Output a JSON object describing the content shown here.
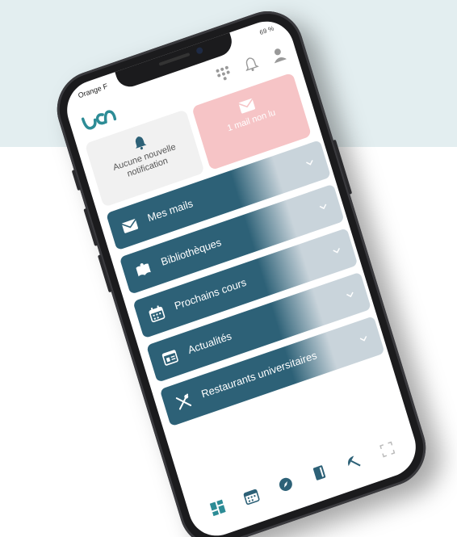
{
  "colors": {
    "background_top": "#e3eef0",
    "accent_teal": "#2d6177",
    "mail_tile": "#f6c4c6",
    "notif_tile": "#f1f1f1",
    "row_fade": "#c9d4db"
  },
  "status_bar": {
    "carrier": "Orange F",
    "battery": "69 %"
  },
  "top_icons": [
    "grid-icon",
    "bell-icon",
    "user-icon"
  ],
  "tiles": [
    {
      "id": "notifications",
      "icon": "bell-icon",
      "label": "Aucune nouvelle notification"
    },
    {
      "id": "mail",
      "icon": "envelope-icon",
      "label": "1 mail non lu"
    }
  ],
  "menu": [
    {
      "id": "mails",
      "icon": "envelope-icon",
      "label": "Mes mails"
    },
    {
      "id": "libraries",
      "icon": "book-icon",
      "label": "Bibliothèques"
    },
    {
      "id": "courses",
      "icon": "calendar-icon",
      "label": "Prochains cours"
    },
    {
      "id": "news",
      "icon": "newspaper-icon",
      "label": "Actualités"
    },
    {
      "id": "restaurants",
      "icon": "cutlery-icon",
      "label": "Restaurants universitaires"
    }
  ],
  "bottom_nav": [
    "dashboard-icon",
    "calendar-icon",
    "compass-icon",
    "book-icon",
    "satellite-icon",
    "expand-icon"
  ]
}
